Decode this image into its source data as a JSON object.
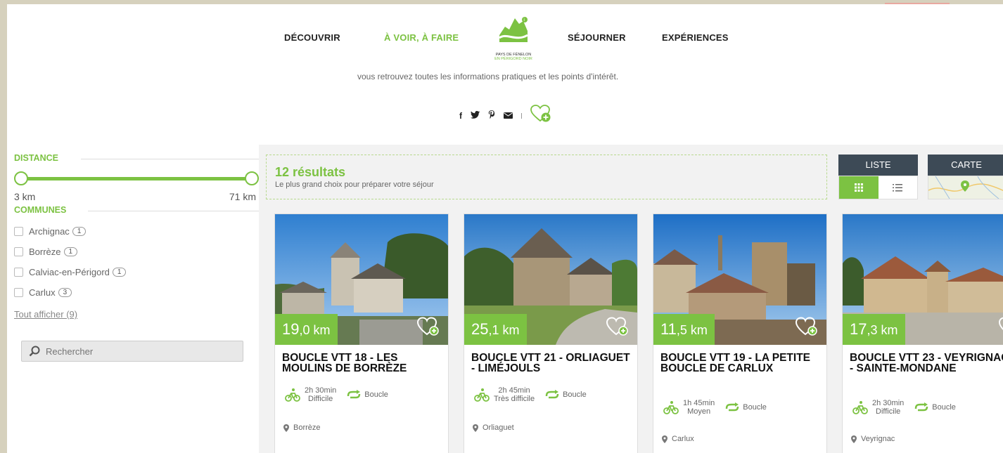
{
  "nav": {
    "items": [
      "DÉCOUVRIR",
      "À VOIR, À FAIRE",
      "SÉJOURNER",
      "EXPÉRIENCES"
    ],
    "logo_line1": "PAYS DE FÉNELON",
    "logo_line2": "EN PÉRIGORD NOIR"
  },
  "intro": "vous retrouvez toutes les informations pratiques et les points d'intérêt.",
  "social": [
    "facebook-icon",
    "twitter-icon",
    "pinterest-icon",
    "mail-icon",
    "favorite-add-icon"
  ],
  "filters": {
    "distance_title": "DISTANCE",
    "min_label": "3 km",
    "max_label": "71 km",
    "communes_title": "COMMUNES",
    "communes": [
      {
        "name": "Archignac",
        "count": "1"
      },
      {
        "name": "Borrèze",
        "count": "1"
      },
      {
        "name": "Calviac-en-Périgord",
        "count": "1"
      },
      {
        "name": "Carlux",
        "count": "3"
      }
    ],
    "show_all": "Tout afficher (9)",
    "search_placeholder": "Rechercher"
  },
  "results": {
    "count": "12 résultats",
    "subtitle": "Le plus grand choix pour préparer votre séjour",
    "list_label": "LISTE",
    "map_label": "CARTE"
  },
  "cards": [
    {
      "dist_int": "19",
      "dist_dec": ",0",
      "unit": " km",
      "title": "BOUCLE VTT 18 - LES MOULINS DE BORRÈZE",
      "duration": "2h 30min",
      "level": "Difficile",
      "type": "Boucle",
      "place": "Borrèze"
    },
    {
      "dist_int": "25",
      "dist_dec": ",1",
      "unit": " km",
      "title": "BOUCLE VTT 21 - ORLIAGUET - LIMÉJOULS",
      "duration": "2h 45min",
      "level": "Très difficile",
      "type": "Boucle",
      "place": "Orliaguet"
    },
    {
      "dist_int": "11",
      "dist_dec": ",5",
      "unit": " km",
      "title": "BOUCLE VTT 19 - LA PETITE BOUCLE DE CARLUX",
      "duration": "1h 45min",
      "level": "Moyen",
      "type": "Boucle",
      "place": "Carlux"
    },
    {
      "dist_int": "17",
      "dist_dec": ",3",
      "unit": " km",
      "title": "BOUCLE VTT 23 - VEYRIGNAC - SAINTE-MONDANE",
      "duration": "2h 30min",
      "level": "Difficile",
      "type": "Boucle",
      "place": "Veyrignac"
    }
  ],
  "colors": {
    "accent": "#7cc242",
    "dark": "#3d4a56"
  }
}
